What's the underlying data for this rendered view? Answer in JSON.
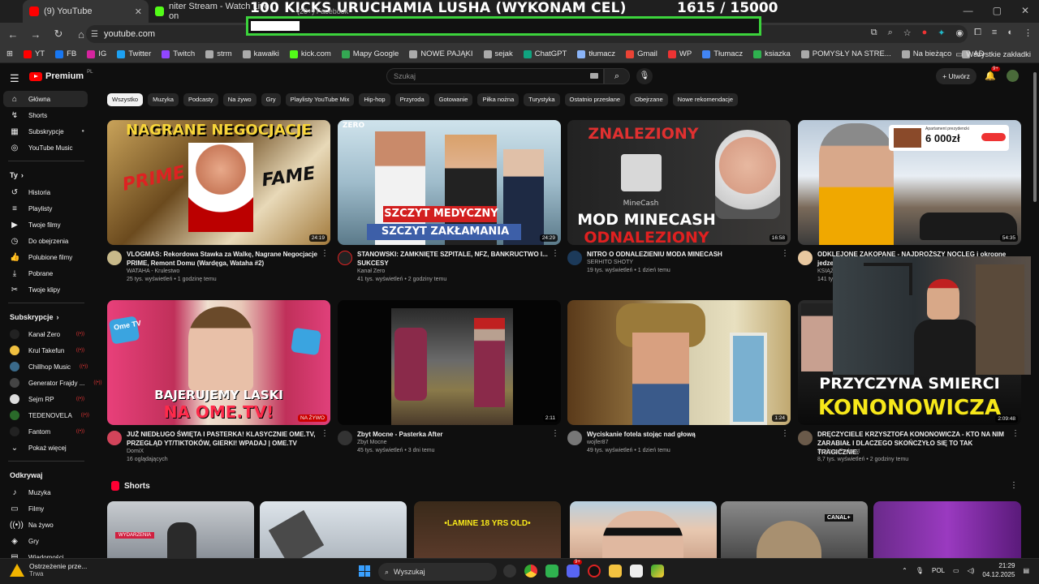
{
  "browser": {
    "tabs": [
      {
        "label": "(9) YouTube",
        "active": true
      },
      {
        "label": "niter Stream - Watch Live on",
        "active": false
      }
    ],
    "overlay": {
      "title": "100 KICKS URUCHAMIA LUSHA (WYKONAM CEL)",
      "count": "1615  / 15000",
      "progress": 0.108,
      "behind_label": "(20+) Facebook"
    },
    "url": "youtube.com",
    "bookmarks": [
      "YT",
      "FB",
      "IG",
      "Twitter",
      "Twitch",
      "strm",
      "kawałki",
      "kick.com",
      "Mapy Google",
      "NOWE PAJĄKI",
      "sejak",
      "ChatGPT",
      "tłumacz",
      "Gmail",
      "WP",
      "Tłumacz",
      "ksiazka",
      "POMYSŁY NA STRE...",
      "Na bieżąco",
      "AD"
    ],
    "bookmarks_other": "Wszystkie zakładki"
  },
  "yt": {
    "logo": "Premium",
    "logo_region": "PL",
    "search_placeholder": "Szukaj",
    "create_label": "Utwórz",
    "notif_badge": "9+",
    "sidebar": {
      "main": [
        "Główna",
        "Shorts",
        "Subskrypcje",
        "YouTube Music"
      ],
      "you_head": "Ty",
      "you": [
        "Historia",
        "Playlisty",
        "Twoje filmy",
        "Do obejrzenia",
        "Polubione filmy",
        "Pobrane",
        "Twoje klipy"
      ],
      "subs_head": "Subskrypcje",
      "subs": [
        "Kanał Zero",
        "Krul Takefun",
        "Chillhop Music",
        "Generator Frajdy ...",
        "Sejm RP",
        "TEDENOVELA",
        "Fantom"
      ],
      "more": "Pokaż więcej",
      "explore_head": "Odkrywaj",
      "explore": [
        "Muzyka",
        "Filmy",
        "Na żywo",
        "Gry",
        "Wiadomości"
      ]
    },
    "chips": [
      "Wszystko",
      "Muzyka",
      "Podcasty",
      "Na żywo",
      "Gry",
      "Playlisty YouTube Mix",
      "Hip-hop",
      "Przyroda",
      "Gotowanie",
      "Piłka nożna",
      "Turystyka",
      "Ostatnio przesłane",
      "Obejrzane",
      "Nowe rekomendacje"
    ],
    "videos": [
      {
        "thumb_text": "NAGRANE NEGOCJACJE",
        "thumb_text2": "PRIME",
        "thumb_text3": "FAME",
        "duration": "24:19",
        "title": "VLOGMAS: Rekordowa Stawka za Walkę, Nagrane Negocjacje PRIME, Remont Domu (Wardęga, Wataha #2)",
        "channel": "WATAHA - Krulestwo",
        "stats": "25 tys. wyświetleń • 1 godzinę temu"
      },
      {
        "thumb_text": "SZCZYT MEDYCZNY",
        "thumb_text2": "SZCZYT ZAKŁAMANIA",
        "thumb_text3": "ZERO",
        "duration": "24:29",
        "title": "STANOWSKI: ZAMKNIĘTE SZPITALE, NFZ, BANKRUCTWO I... SUKCESY",
        "channel": "Kanał Zero",
        "stats": "41 tys. wyświetleń • 2 godziny temu"
      },
      {
        "thumb_text": "ZNALEZIONY",
        "thumb_text2": "MOD MINECASH",
        "thumb_text3": "ODNALEZIONY",
        "thumb_text4": "MineCash",
        "duration": "16:58",
        "title": "NITRO O ODNALEZIENIU MODA MINECASH",
        "channel": "SERHITO SHOTY",
        "stats": "19 tys. wyświetleń • 1 dzień temu"
      },
      {
        "thumb_text": "6 000zł",
        "thumb_text2": "Apartament prezydencki",
        "duration": "54:35",
        "title": "ODKLEJONE ZAKOPANE - NAJDROŻSZY NOCLEG i okropne jedze...",
        "channel": "KSIĄŻ...",
        "stats": "141 ty..."
      },
      {
        "thumb_text": "BAJERUJEMY LASKI",
        "thumb_text2": "NA OME.TV!",
        "thumb_text3": "Ome TV",
        "duration": "NA ŻYWO",
        "title": "JUŻ NIEDŁUGO ŚWIĘTA I PASTERKA! KLASYCZNIE OME.TV, PRZEGLĄD YT/TIKTOKÓW, GIERKI! WPADAJ | OME.TV",
        "channel": "DomiX",
        "stats": "16 oglądających"
      },
      {
        "duration": "2:11",
        "title": "Zbyt Mocne - Pasterka After",
        "channel": "Zbyt Mocne",
        "stats": "45 tys. wyświetleń • 3 dni temu"
      },
      {
        "duration": "1:24",
        "title": "Wyciskanie fotela stojąc nad głową",
        "channel": "wojfer87",
        "stats": "49 tys. wyświetleń • 1 dzień temu"
      },
      {
        "thumb_text": "PRZYCZYNA SMIERCI",
        "thumb_text2": "KONONOWICZA",
        "duration": "2:09:48",
        "title": "DRĘCZYCIELE KRZYSZTOFA KONONOWICZA - KTO NA NIM ZARABIAŁ I DLACZEGO SKOŃCZYŁO SIĘ TO TAK TRAGICZNIE.",
        "channel": "Szalony Podcast",
        "stats": "8,7 tys. wyświetleń • 2 godziny temu"
      }
    ],
    "shorts_head": "Shorts",
    "shorts_texts": [
      "WYDARZENIA",
      "",
      "•LAMINE 18 YRS OLD•",
      "",
      "CANAL+",
      ""
    ]
  },
  "taskbar": {
    "warn_title": "Ostrzeżenie prze...",
    "warn_sub": "Trwa",
    "search": "Wyszukaj",
    "lang": "POL",
    "time": "21:29",
    "date": "04.12.2025",
    "badge": "9+"
  },
  "colors": {
    "accent": "#ff0000",
    "overlay_border": "#3cd33c",
    "bg": "#0f0f0f"
  }
}
